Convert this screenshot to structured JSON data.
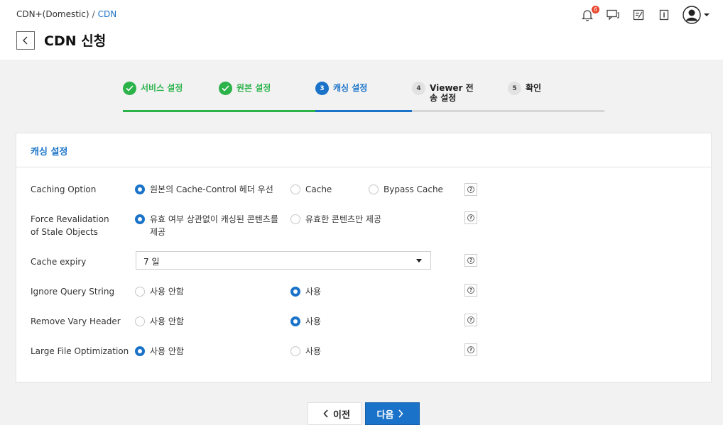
{
  "breadcrumb": {
    "parent": "CDN+(Domestic)",
    "separator": "/",
    "current": "CDN"
  },
  "page_title": "CDN 신청",
  "header": {
    "notification_count": "6"
  },
  "steps": [
    {
      "label": "서비스 설정",
      "number": "1",
      "state": "done"
    },
    {
      "label": "원본 설정",
      "number": "2",
      "state": "done"
    },
    {
      "label": "캐싱 설정",
      "number": "3",
      "state": "active"
    },
    {
      "label": "Viewer 전송 설정",
      "number": "4",
      "state": "todo"
    },
    {
      "label": "확인",
      "number": "5",
      "state": "todo"
    }
  ],
  "card": {
    "title": "캐싱 설정",
    "rows": {
      "caching_option": {
        "label": "Caching Option",
        "options": [
          "원본의 Cache-Control 헤더 우선",
          "Cache",
          "Bypass Cache"
        ],
        "selected": 0
      },
      "force_revalidation": {
        "label": "Force Revalidation of Stale Objects",
        "options": [
          "유효 여부 상관없이 캐싱된 콘텐츠를 제공",
          "유효한 콘텐츠만 제공"
        ],
        "selected": 0
      },
      "cache_expiry": {
        "label": "Cache expiry",
        "value": "7 일"
      },
      "ignore_query_string": {
        "label": "Ignore Query String",
        "options": [
          "사용 안함",
          "사용"
        ],
        "selected": 1
      },
      "remove_vary_header": {
        "label": "Remove Vary Header",
        "options": [
          "사용 안함",
          "사용"
        ],
        "selected": 1
      },
      "large_file_optimization": {
        "label": "Large File Optimization",
        "options": [
          "사용 안함",
          "사용"
        ],
        "selected": 0
      }
    }
  },
  "buttons": {
    "prev": "이전",
    "next": "다음"
  },
  "colors": {
    "accent": "#1a73c8",
    "success": "#2bb34a",
    "badge": "#e8452b"
  },
  "icons": [
    "back-icon",
    "bell-icon",
    "chat-icon",
    "memo-icon",
    "book-icon",
    "avatar-icon",
    "chevron-down-icon",
    "help-icon",
    "check-icon"
  ]
}
